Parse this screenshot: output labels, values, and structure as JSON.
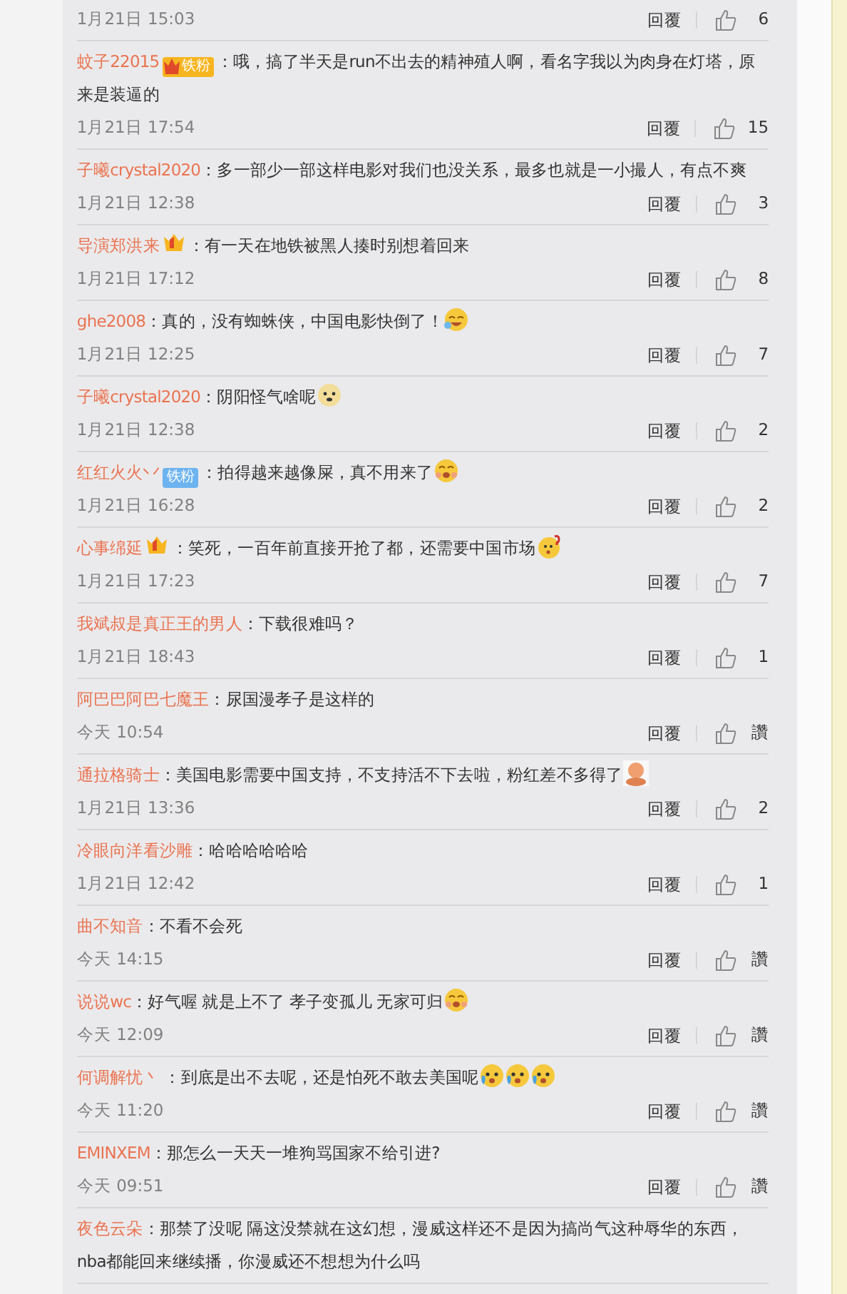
{
  "comments": [
    {
      "time": "1月21日 15:03",
      "reply": "回覆",
      "likes": "6"
    },
    {
      "user": "蚊子22015",
      "badges": [
        {
          "kind": "vip_fan",
          "label": "铁粉"
        }
      ],
      "text": "：哦，搞了半天是run不出去的精神殖人啊，看名字我以为肉身在灯塔，原来是装逼的",
      "time": "1月21日 17:54",
      "reply": "回覆",
      "likes": "15"
    },
    {
      "user": "子曦crystal2020",
      "text": "：多一部少一部这样电影对我们也没关系，最多也就是一小撮人，有点不爽",
      "time": "1月21日 12:38",
      "reply": "回覆",
      "likes": "3"
    },
    {
      "user": "导演郑洪来",
      "badges": [
        {
          "kind": "vip"
        }
      ],
      "text": "：有一天在地铁被黑人揍时别想着回来",
      "time": "1月21日 17:12",
      "reply": "回覆",
      "likes": "8"
    },
    {
      "user": "ghe2008",
      "text": "：真的，没有蜘蛛侠，中国电影快倒了！",
      "emojis": [
        {
          "kind": "laugh"
        }
      ],
      "time": "1月21日 12:25",
      "reply": "回覆",
      "likes": "7"
    },
    {
      "user": "子曦crystal2020",
      "text": "：阴阳怪气啥呢",
      "emojis": [
        {
          "kind": "dog"
        }
      ],
      "time": "1月21日 12:38",
      "reply": "回覆",
      "likes": "2"
    },
    {
      "user": "红红火火丷",
      "badges": [
        {
          "kind": "fan",
          "label": "铁粉"
        }
      ],
      "text": "：拍得越来越像屎，真不用来了",
      "emojis": [
        {
          "kind": "shocked"
        }
      ],
      "time": "1月21日 16:28",
      "reply": "回覆",
      "likes": "2"
    },
    {
      "user": "心事绵延",
      "badges": [
        {
          "kind": "vip"
        }
      ],
      "text": "：笑死，一百年前直接开抢了都，还需要中国市场",
      "emojis": [
        {
          "kind": "puzzled"
        }
      ],
      "time": "1月21日 17:23",
      "reply": "回覆",
      "likes": "7"
    },
    {
      "user": "我斌叔是真正王的男人",
      "text": "：下载很难吗？",
      "time": "1月21日 18:43",
      "reply": "回覆",
      "likes": "1"
    },
    {
      "user": "阿巴巴阿巴七魔王",
      "text": "：尿国漫孝子是这样的",
      "time": "今天 10:54",
      "reply": "回覆",
      "likes": "讚"
    },
    {
      "user": "通拉格骑士",
      "text": "：美国电影需要中国支持，不支持活不下去啦，粉红差不多得了",
      "emojis": [
        {
          "kind": "figure"
        }
      ],
      "time": "1月21日 13:36",
      "reply": "回覆",
      "likes": "2"
    },
    {
      "user": "冷眼向洋看沙雕",
      "text": "：哈哈哈哈哈哈",
      "time": "1月21日 12:42",
      "reply": "回覆",
      "likes": "1"
    },
    {
      "user": "曲不知音",
      "text": "：不看不会死",
      "time": "今天 14:15",
      "reply": "回覆",
      "likes": "讚"
    },
    {
      "user": "说说wc",
      "text": "：好气喔 就是上不了 孝子变孤儿 无家可归",
      "emojis": [
        {
          "kind": "shocked"
        }
      ],
      "time": "今天 12:09",
      "reply": "回覆",
      "likes": "讚"
    },
    {
      "user": "何调解忧丶",
      "text": " ：到底是出不去呢，还是怕死不敢去美国呢",
      "emojis": [
        {
          "kind": "crying"
        },
        {
          "kind": "crying"
        },
        {
          "kind": "crying"
        }
      ],
      "time": "今天 11:20",
      "reply": "回覆",
      "likes": "讚"
    },
    {
      "user": "EMINXEM",
      "text": "：那怎么一天天一堆狗骂国家不给引进?",
      "time": "今天 09:51",
      "reply": "回覆",
      "likes": "讚"
    },
    {
      "user": "夜色云朵",
      "text": "：那禁了没呢 隔这没禁就在这幻想，漫威这样还不是因为搞尚气这种辱华的东西，nba都能回来继续播，你漫威还不想想为什么吗"
    }
  ]
}
